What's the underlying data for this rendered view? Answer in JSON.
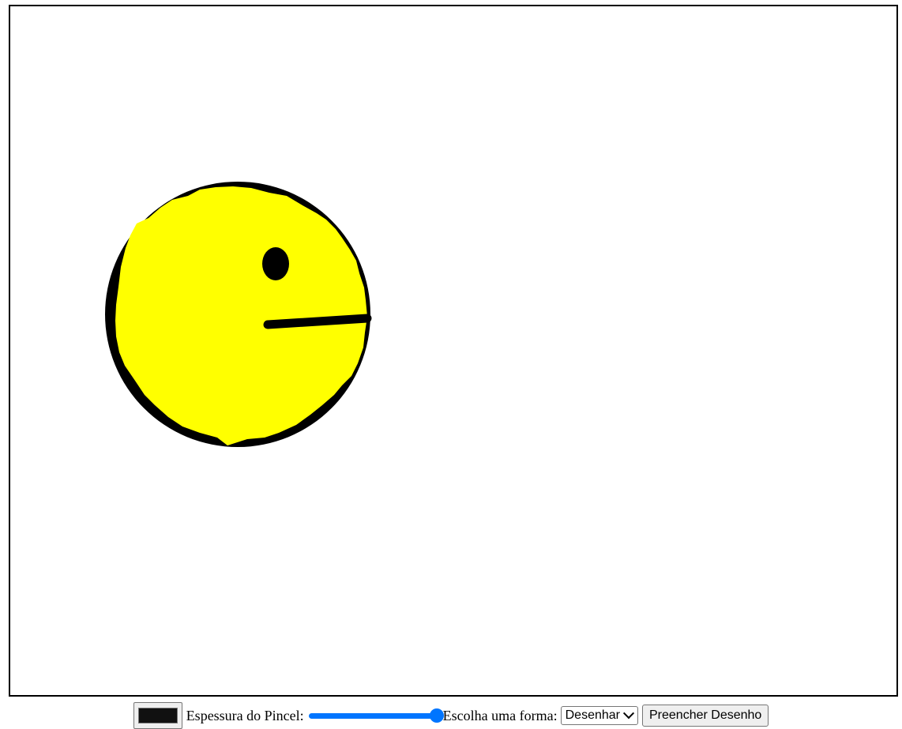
{
  "canvas": {
    "drawing": {
      "shape": "circle",
      "fill_color": "#ffff00",
      "stroke_color": "#000000"
    }
  },
  "toolbar": {
    "color_value": "#111111",
    "brush_label": "Espessura do Pincel:",
    "brush_level": 1.0,
    "shape_label": "Escolha uma forma:",
    "shape_selected": "Desenhar",
    "fill_button": "Preencher Desenho"
  }
}
